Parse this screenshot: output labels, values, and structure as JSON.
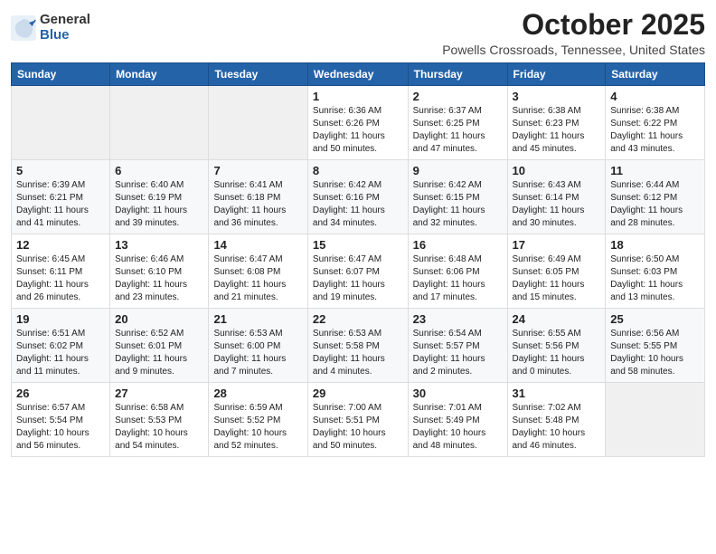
{
  "logo": {
    "general": "General",
    "blue": "Blue"
  },
  "title": "October 2025",
  "location": "Powells Crossroads, Tennessee, United States",
  "days_of_week": [
    "Sunday",
    "Monday",
    "Tuesday",
    "Wednesday",
    "Thursday",
    "Friday",
    "Saturday"
  ],
  "weeks": [
    [
      {
        "day": "",
        "info": ""
      },
      {
        "day": "",
        "info": ""
      },
      {
        "day": "",
        "info": ""
      },
      {
        "day": "1",
        "info": "Sunrise: 6:36 AM\nSunset: 6:26 PM\nDaylight: 11 hours\nand 50 minutes."
      },
      {
        "day": "2",
        "info": "Sunrise: 6:37 AM\nSunset: 6:25 PM\nDaylight: 11 hours\nand 47 minutes."
      },
      {
        "day": "3",
        "info": "Sunrise: 6:38 AM\nSunset: 6:23 PM\nDaylight: 11 hours\nand 45 minutes."
      },
      {
        "day": "4",
        "info": "Sunrise: 6:38 AM\nSunset: 6:22 PM\nDaylight: 11 hours\nand 43 minutes."
      }
    ],
    [
      {
        "day": "5",
        "info": "Sunrise: 6:39 AM\nSunset: 6:21 PM\nDaylight: 11 hours\nand 41 minutes."
      },
      {
        "day": "6",
        "info": "Sunrise: 6:40 AM\nSunset: 6:19 PM\nDaylight: 11 hours\nand 39 minutes."
      },
      {
        "day": "7",
        "info": "Sunrise: 6:41 AM\nSunset: 6:18 PM\nDaylight: 11 hours\nand 36 minutes."
      },
      {
        "day": "8",
        "info": "Sunrise: 6:42 AM\nSunset: 6:16 PM\nDaylight: 11 hours\nand 34 minutes."
      },
      {
        "day": "9",
        "info": "Sunrise: 6:42 AM\nSunset: 6:15 PM\nDaylight: 11 hours\nand 32 minutes."
      },
      {
        "day": "10",
        "info": "Sunrise: 6:43 AM\nSunset: 6:14 PM\nDaylight: 11 hours\nand 30 minutes."
      },
      {
        "day": "11",
        "info": "Sunrise: 6:44 AM\nSunset: 6:12 PM\nDaylight: 11 hours\nand 28 minutes."
      }
    ],
    [
      {
        "day": "12",
        "info": "Sunrise: 6:45 AM\nSunset: 6:11 PM\nDaylight: 11 hours\nand 26 minutes."
      },
      {
        "day": "13",
        "info": "Sunrise: 6:46 AM\nSunset: 6:10 PM\nDaylight: 11 hours\nand 23 minutes."
      },
      {
        "day": "14",
        "info": "Sunrise: 6:47 AM\nSunset: 6:08 PM\nDaylight: 11 hours\nand 21 minutes."
      },
      {
        "day": "15",
        "info": "Sunrise: 6:47 AM\nSunset: 6:07 PM\nDaylight: 11 hours\nand 19 minutes."
      },
      {
        "day": "16",
        "info": "Sunrise: 6:48 AM\nSunset: 6:06 PM\nDaylight: 11 hours\nand 17 minutes."
      },
      {
        "day": "17",
        "info": "Sunrise: 6:49 AM\nSunset: 6:05 PM\nDaylight: 11 hours\nand 15 minutes."
      },
      {
        "day": "18",
        "info": "Sunrise: 6:50 AM\nSunset: 6:03 PM\nDaylight: 11 hours\nand 13 minutes."
      }
    ],
    [
      {
        "day": "19",
        "info": "Sunrise: 6:51 AM\nSunset: 6:02 PM\nDaylight: 11 hours\nand 11 minutes."
      },
      {
        "day": "20",
        "info": "Sunrise: 6:52 AM\nSunset: 6:01 PM\nDaylight: 11 hours\nand 9 minutes."
      },
      {
        "day": "21",
        "info": "Sunrise: 6:53 AM\nSunset: 6:00 PM\nDaylight: 11 hours\nand 7 minutes."
      },
      {
        "day": "22",
        "info": "Sunrise: 6:53 AM\nSunset: 5:58 PM\nDaylight: 11 hours\nand 4 minutes."
      },
      {
        "day": "23",
        "info": "Sunrise: 6:54 AM\nSunset: 5:57 PM\nDaylight: 11 hours\nand 2 minutes."
      },
      {
        "day": "24",
        "info": "Sunrise: 6:55 AM\nSunset: 5:56 PM\nDaylight: 11 hours\nand 0 minutes."
      },
      {
        "day": "25",
        "info": "Sunrise: 6:56 AM\nSunset: 5:55 PM\nDaylight: 10 hours\nand 58 minutes."
      }
    ],
    [
      {
        "day": "26",
        "info": "Sunrise: 6:57 AM\nSunset: 5:54 PM\nDaylight: 10 hours\nand 56 minutes."
      },
      {
        "day": "27",
        "info": "Sunrise: 6:58 AM\nSunset: 5:53 PM\nDaylight: 10 hours\nand 54 minutes."
      },
      {
        "day": "28",
        "info": "Sunrise: 6:59 AM\nSunset: 5:52 PM\nDaylight: 10 hours\nand 52 minutes."
      },
      {
        "day": "29",
        "info": "Sunrise: 7:00 AM\nSunset: 5:51 PM\nDaylight: 10 hours\nand 50 minutes."
      },
      {
        "day": "30",
        "info": "Sunrise: 7:01 AM\nSunset: 5:49 PM\nDaylight: 10 hours\nand 48 minutes."
      },
      {
        "day": "31",
        "info": "Sunrise: 7:02 AM\nSunset: 5:48 PM\nDaylight: 10 hours\nand 46 minutes."
      },
      {
        "day": "",
        "info": ""
      }
    ]
  ]
}
